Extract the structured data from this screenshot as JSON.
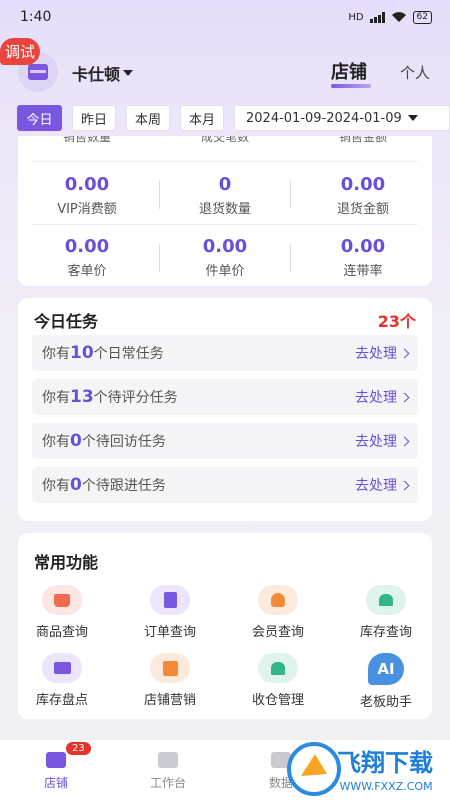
{
  "status_bar": {
    "time": "1:40",
    "network": "HD",
    "battery": "62"
  },
  "header": {
    "debug_badge": "调试",
    "store_name": "卡仕顿",
    "tab_store": "店铺",
    "tab_personal": "个人"
  },
  "date_filter": {
    "buttons": [
      "今日",
      "昨日",
      "本周",
      "本月"
    ],
    "active": "今日",
    "range": "2024-01-09-2024-01-09"
  },
  "stats": {
    "cut_labels": [
      "销售数量",
      "成交笔数",
      "销售金额"
    ],
    "rows": [
      [
        {
          "value": "0.00",
          "label": "VIP消费额"
        },
        {
          "value": "0",
          "label": "退货数量"
        },
        {
          "value": "0.00",
          "label": "退货金额"
        }
      ],
      [
        {
          "value": "0.00",
          "label": "客单价"
        },
        {
          "value": "0.00",
          "label": "件单价"
        },
        {
          "value": "0.00",
          "label": "连带率"
        }
      ]
    ]
  },
  "tasks": {
    "title": "今日任务",
    "count": "23个",
    "items": [
      {
        "prefix": "你有",
        "num": "10",
        "suffix": "个日常任务",
        "action": "去处理"
      },
      {
        "prefix": "你有",
        "num": "13",
        "suffix": "个待评分任务",
        "action": "去处理"
      },
      {
        "prefix": "你有",
        "num": "0",
        "suffix": "个待回访任务",
        "action": "去处理"
      },
      {
        "prefix": "你有",
        "num": "0",
        "suffix": "个待跟进任务",
        "action": "去处理"
      }
    ]
  },
  "functions": {
    "title": "常用功能",
    "items": [
      {
        "label": "商品查询",
        "icon": "bag-icon",
        "bg": "#fde7e2",
        "color": "#f06b50"
      },
      {
        "label": "订单查询",
        "icon": "order-search-icon",
        "bg": "#ece5fb",
        "color": "#7a57e0"
      },
      {
        "label": "会员查询",
        "icon": "member-icon",
        "bg": "#feeadb",
        "color": "#f28a3a"
      },
      {
        "label": "库存查询",
        "icon": "warehouse-icon",
        "bg": "#e0f4ee",
        "color": "#34b48a"
      },
      {
        "label": "库存盘点",
        "icon": "inventory-icon",
        "bg": "#ece5fb",
        "color": "#7a57e0"
      },
      {
        "label": "店铺营销",
        "icon": "gift-icon",
        "bg": "#feeadb",
        "color": "#f28a3a"
      },
      {
        "label": "收仓管理",
        "icon": "store-house-icon",
        "bg": "#e0f4ee",
        "color": "#34b48a"
      },
      {
        "label": "老板助手",
        "icon": "ai-icon",
        "bg": "#4a90e2",
        "color": "#ffffff",
        "text": "AI"
      }
    ]
  },
  "bottom_nav": {
    "items": [
      {
        "label": "店铺",
        "active": true,
        "badge": "23"
      },
      {
        "label": "工作台",
        "active": false
      },
      {
        "label": "数据",
        "active": false
      }
    ]
  },
  "watermark": {
    "text": "飞翔下载",
    "url": "WWW.FXXZ.COM"
  },
  "colors": {
    "accent": "#7a57e0",
    "accent_text": "#6c4fd8",
    "alert": "#e5322d"
  }
}
